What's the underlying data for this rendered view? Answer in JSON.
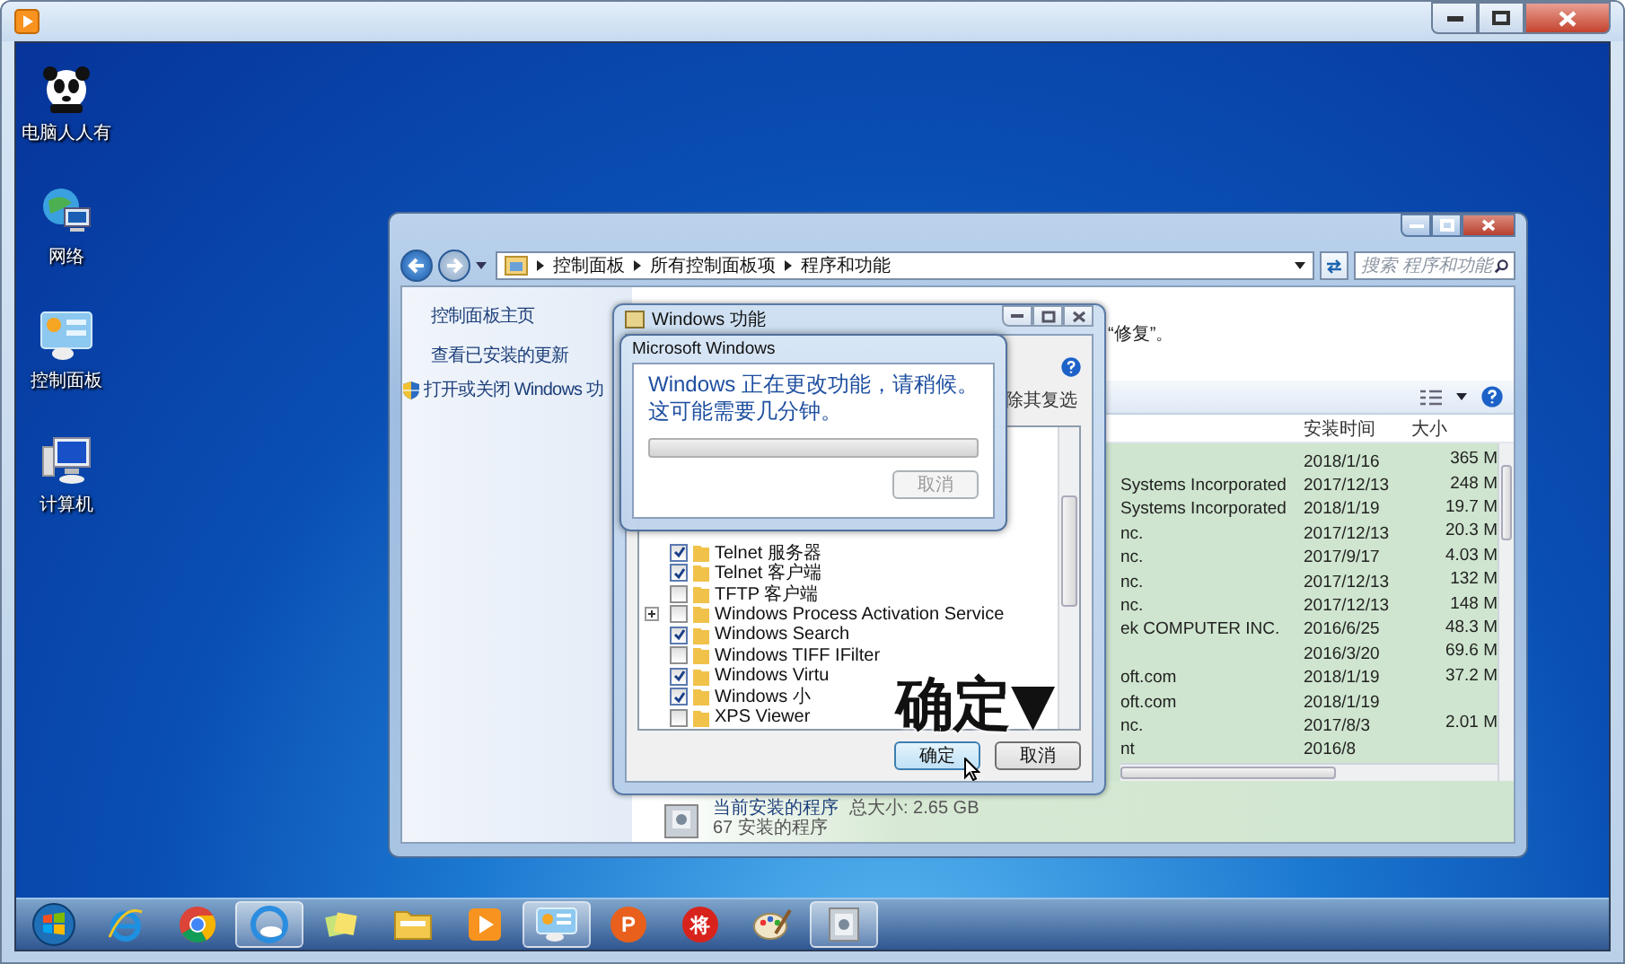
{
  "desktop_icons": [
    {
      "label": "电脑人人有",
      "kind": "panda"
    },
    {
      "label": "网络",
      "kind": "network"
    },
    {
      "label": "控制面板",
      "kind": "control-panel"
    },
    {
      "label": "计算机",
      "kind": "computer"
    }
  ],
  "control_panel": {
    "breadcrumbs": [
      "控制面板",
      "所有控制面板项",
      "程序和功能"
    ],
    "search": {
      "placeholder": "搜索 程序和功能"
    },
    "sidebar": {
      "items": [
        {
          "label": "控制面板主页",
          "kind": "link"
        },
        {
          "label": "查看已安装的更新",
          "kind": "link"
        },
        {
          "label": "打开或关闭 Windows 功",
          "kind": "shield-link"
        }
      ]
    },
    "hint_text": "“修复”。",
    "table": {
      "columns": [
        "安装时间",
        "大小"
      ],
      "rows": [
        {
          "installed": "2018/1/16",
          "size": "365 M"
        },
        {
          "publisher": "Systems Incorporated",
          "installed": "2017/12/13",
          "size": "248 M"
        },
        {
          "publisher": "Systems Incorporated",
          "installed": "2018/1/19",
          "size": "19.7 M"
        },
        {
          "publisher": "nc.",
          "installed": "2017/12/13",
          "size": "20.3 M"
        },
        {
          "publisher": "nc.",
          "installed": "2017/9/17",
          "size": "4.03 M"
        },
        {
          "publisher": "nc.",
          "installed": "2017/12/13",
          "size": "132 M"
        },
        {
          "publisher": "nc.",
          "installed": "2017/12/13",
          "size": "148 M"
        },
        {
          "publisher": "ek COMPUTER INC.",
          "installed": "2016/6/25",
          "size": "48.3 M"
        },
        {
          "installed": "2016/3/20",
          "size": "69.6 M"
        },
        {
          "publisher": "oft.com",
          "installed": "2018/1/19",
          "size": "37.2 M"
        },
        {
          "publisher": "oft.com",
          "installed": "2018/1/19"
        },
        {
          "publisher": "nc.",
          "installed": "2017/8/3",
          "size": "2.01 M"
        },
        {
          "publisher": "nt",
          "installed": "2016/8"
        }
      ]
    },
    "footer": {
      "title": "当前安装的程序",
      "total_size": "总大小: 2.65 GB",
      "count": "67 安装的程序"
    }
  },
  "features_dialog": {
    "title": "Windows 功能",
    "description_fragment": "除其复选",
    "features": [
      {
        "label": "Telnet 服务器",
        "checked": true,
        "expandable": false
      },
      {
        "label": "Telnet 客户端",
        "checked": true,
        "expandable": false
      },
      {
        "label": "TFTP 客户端",
        "checked": false,
        "expandable": false
      },
      {
        "label": "Windows Process Activation Service",
        "checked": false,
        "expandable": true
      },
      {
        "label": "Windows Search",
        "checked": true,
        "expandable": false
      },
      {
        "label": "Windows TIFF IFilter",
        "checked": false,
        "expandable": false
      },
      {
        "label": "Windows Virtu",
        "checked": true,
        "expandable": false
      },
      {
        "label": "Windows 小",
        "checked": true,
        "expandable": false
      },
      {
        "label": "XPS Viewer",
        "checked": false,
        "expandable": false
      }
    ],
    "buttons": [
      {
        "label": "确定",
        "kind": "default"
      },
      {
        "label": "取消",
        "kind": "normal"
      }
    ]
  },
  "progress_dialog": {
    "title": "Microsoft Windows",
    "level": 0,
    "message": "Windows 正在更改功能，请稍候。这可能需要几分钟。",
    "cancel": {
      "label": "取消",
      "disabled": true
    }
  },
  "annotation": {
    "text": "确定▼"
  },
  "taskbar": {
    "items": [
      {
        "kind": "start",
        "active": false
      },
      {
        "kind": "ie",
        "active": false
      },
      {
        "kind": "chrome",
        "active": false
      },
      {
        "kind": "cloud",
        "active": true
      },
      {
        "kind": "notes",
        "active": false
      },
      {
        "kind": "folder",
        "active": false
      },
      {
        "kind": "media",
        "active": false
      },
      {
        "kind": "control-panel",
        "active": true
      },
      {
        "kind": "letter",
        "glyph": "P",
        "active": false
      },
      {
        "kind": "seal",
        "glyph": "将",
        "active": false
      },
      {
        "kind": "paint",
        "active": false
      },
      {
        "kind": "features",
        "active": true
      }
    ]
  }
}
